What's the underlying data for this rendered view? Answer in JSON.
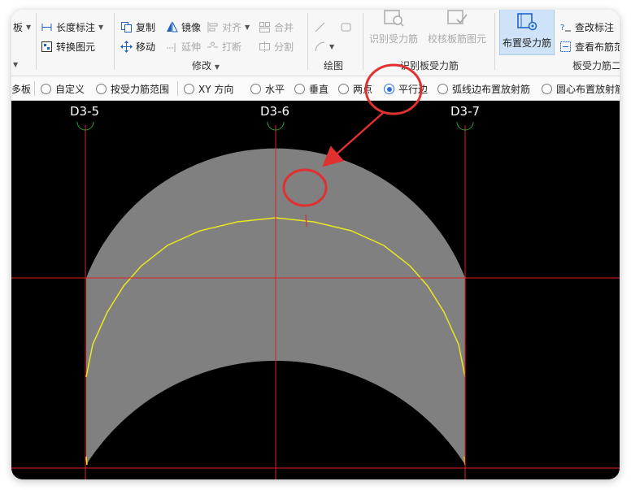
{
  "ribbon": {
    "edit_tools": {
      "length_dim": "长度标注",
      "convert": "转换图元",
      "copy": "复制",
      "mirror": "镜像",
      "align": "对齐",
      "merge": "合并",
      "move": "移动",
      "extend": "延伸",
      "break": "打断",
      "split": "分割"
    },
    "left_partial": "板",
    "groups": {
      "modify": "修改",
      "draw": "绘图",
      "recognize": "识别板受力筋",
      "slab_rebar": "板受力筋二"
    },
    "recognize_buttons": {
      "identify": "识别受力筋",
      "check": "校核板筋图元"
    },
    "place_button": "布置受力筋",
    "right_tools": {
      "check_dim": "查改标注",
      "view_range": "查看布筋范"
    }
  },
  "options": {
    "partial_first": "多板",
    "items": [
      "自定义",
      "按受力筋范围",
      "XY 方向",
      "水平",
      "垂直",
      "两点",
      "平行边",
      "弧线边布置放射筋",
      "圆心布置放射筋"
    ],
    "selected": "平行边"
  },
  "canvas": {
    "axes": [
      "D3-5",
      "D3-6",
      "D3-7"
    ],
    "colors": {
      "background": "#000000",
      "axis_line": "#e02020",
      "axis_bubble": "#2fa02f",
      "slab_fill": "#808080",
      "rebar": "#e8e81e",
      "annotation": "#e03030"
    }
  }
}
